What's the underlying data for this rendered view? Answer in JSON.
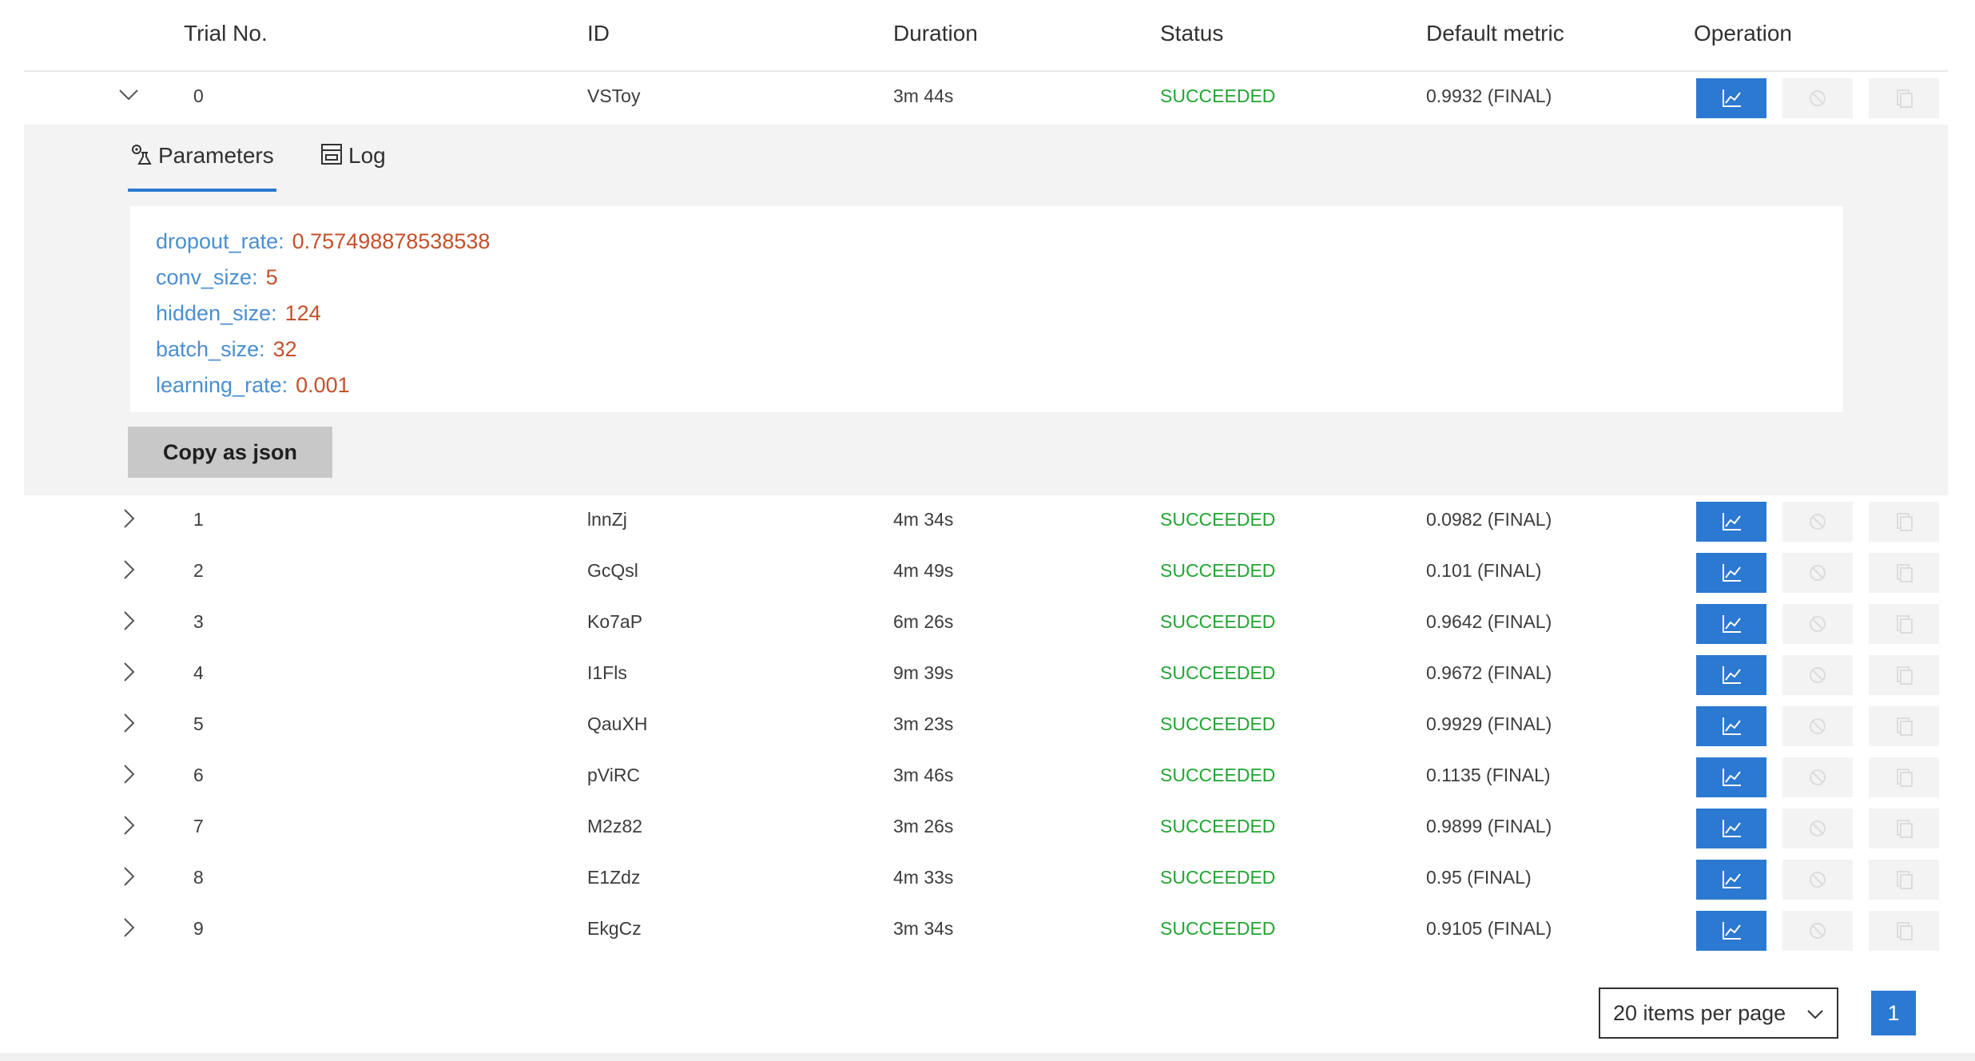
{
  "header": {
    "trial_no": "Trial No.",
    "id": "ID",
    "duration": "Duration",
    "status": "Status",
    "default_metric": "Default metric",
    "operation": "Operation"
  },
  "rows": [
    {
      "trial": "0",
      "id": "VSToy",
      "duration": "3m 44s",
      "status": "SUCCEEDED",
      "metric": "0.9932 (FINAL)",
      "expanded": true
    },
    {
      "trial": "1",
      "id": "lnnZj",
      "duration": "4m 34s",
      "status": "SUCCEEDED",
      "metric": "0.0982 (FINAL)"
    },
    {
      "trial": "2",
      "id": "GcQsl",
      "duration": "4m 49s",
      "status": "SUCCEEDED",
      "metric": "0.101 (FINAL)"
    },
    {
      "trial": "3",
      "id": "Ko7aP",
      "duration": "6m 26s",
      "status": "SUCCEEDED",
      "metric": "0.9642 (FINAL)"
    },
    {
      "trial": "4",
      "id": "I1Fls",
      "duration": "9m 39s",
      "status": "SUCCEEDED",
      "metric": "0.9672 (FINAL)"
    },
    {
      "trial": "5",
      "id": "QauXH",
      "duration": "3m 23s",
      "status": "SUCCEEDED",
      "metric": "0.9929 (FINAL)"
    },
    {
      "trial": "6",
      "id": "pViRC",
      "duration": "3m 46s",
      "status": "SUCCEEDED",
      "metric": "0.1135 (FINAL)"
    },
    {
      "trial": "7",
      "id": "M2z82",
      "duration": "3m 26s",
      "status": "SUCCEEDED",
      "metric": "0.9899 (FINAL)"
    },
    {
      "trial": "8",
      "id": "E1Zdz",
      "duration": "4m 33s",
      "status": "SUCCEEDED",
      "metric": "0.95 (FINAL)"
    },
    {
      "trial": "9",
      "id": "EkgCz",
      "duration": "3m 34s",
      "status": "SUCCEEDED",
      "metric": "0.9105 (FINAL)"
    }
  ],
  "detail": {
    "tabs": [
      {
        "label": "Parameters",
        "icon": "parameters-icon",
        "active": true
      },
      {
        "label": "Log",
        "icon": "log-icon",
        "active": false
      }
    ],
    "parameters": [
      {
        "key": "dropout_rate:",
        "value": "0.757498878538538"
      },
      {
        "key": "conv_size:",
        "value": "5"
      },
      {
        "key": "hidden_size:",
        "value": "124"
      },
      {
        "key": "batch_size:",
        "value": "32"
      },
      {
        "key": "learning_rate:",
        "value": "0.001"
      }
    ],
    "copy_button": "Copy as json"
  },
  "operations": {
    "icons": [
      "chart-icon",
      "cancel-icon",
      "copy-icon"
    ]
  },
  "pagination": {
    "page_size": "20 items per page",
    "current_page": "1"
  },
  "colors": {
    "accent": "#2b79d0",
    "status_succeeded": "#22a532",
    "param_key": "#4a8fd1",
    "param_value": "#c4512a"
  }
}
